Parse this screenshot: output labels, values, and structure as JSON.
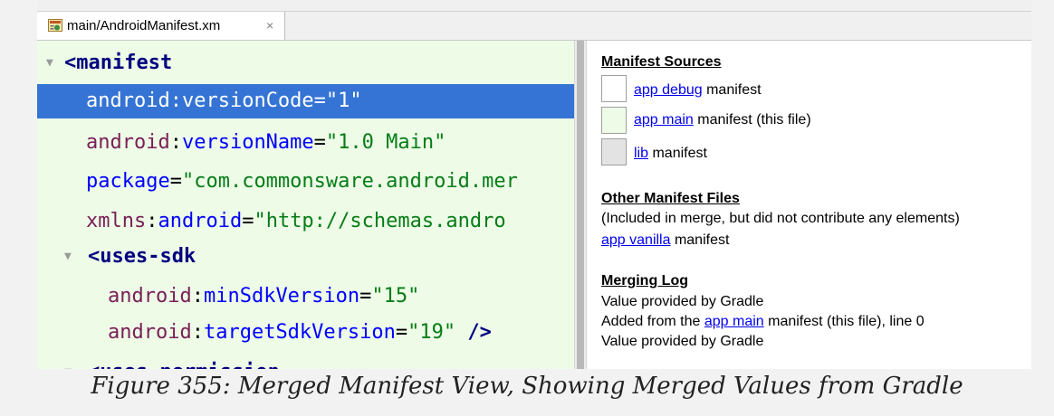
{
  "editor_tab": {
    "title": "main/AndroidManifest.xm",
    "close": "×",
    "icon": "xml-file-icon"
  },
  "xml_editor": {
    "selected_line": 1,
    "lines": [
      {
        "fold": "▼",
        "parts": [
          [
            "bracket",
            "<manifest"
          ]
        ]
      },
      {
        "parts": [
          [
            "ns",
            "android"
          ],
          [
            "eq",
            ":"
          ],
          [
            "attr",
            "versionCode"
          ],
          [
            "eq",
            "="
          ],
          [
            "val",
            "\"1\""
          ]
        ]
      },
      {
        "parts": [
          [
            "ns",
            "android"
          ],
          [
            "eq",
            ":"
          ],
          [
            "attr",
            "versionName"
          ],
          [
            "eq",
            "="
          ],
          [
            "val",
            "\"1.0 Main\""
          ]
        ]
      },
      {
        "parts": [
          [
            "attr",
            "package"
          ],
          [
            "eq",
            "="
          ],
          [
            "val",
            "\"com.commonsware.android.mer"
          ]
        ]
      },
      {
        "parts": [
          [
            "ns",
            "xmlns"
          ],
          [
            "eq",
            ":"
          ],
          [
            "attr",
            "android"
          ],
          [
            "eq",
            "="
          ],
          [
            "val",
            "\"http://schemas.andro"
          ]
        ]
      },
      {
        "fold": "▼",
        "parts": [
          [
            "bracket",
            "<uses-sdk"
          ]
        ]
      },
      {
        "parts": [
          [
            "ns",
            "android"
          ],
          [
            "eq",
            ":"
          ],
          [
            "attr",
            "minSdkVersion"
          ],
          [
            "eq",
            "="
          ],
          [
            "val",
            "\"15\""
          ]
        ]
      },
      {
        "parts": [
          [
            "ns",
            "android"
          ],
          [
            "eq",
            ":"
          ],
          [
            "attr",
            "targetSdkVersion"
          ],
          [
            "eq",
            "="
          ],
          [
            "val",
            "\"19\""
          ],
          [
            "bracket",
            " />"
          ]
        ]
      },
      {
        "fold": "▼",
        "parts": [
          [
            "bracket",
            "<uses-permission"
          ]
        ]
      }
    ]
  },
  "manifest_sources": {
    "heading": "Manifest Sources",
    "items": [
      {
        "link": "app debug",
        "rest": " manifest",
        "swatch_color": "#ffffff"
      },
      {
        "link": "app main",
        "rest": " manifest (this file)",
        "swatch_color": "#edfbe7"
      },
      {
        "link": "lib",
        "rest": " manifest",
        "swatch_color": "#e3e3e3"
      }
    ]
  },
  "other_manifest_files": {
    "heading": "Other Manifest Files",
    "note": "(Included in merge, but did not contribute any elements)",
    "link": "app vanilla",
    "rest": " manifest"
  },
  "merging_log": {
    "heading": "Merging Log",
    "line1": "Value provided by Gradle",
    "line2_prefix": "Added from the ",
    "line2_link": "app main",
    "line2_suffix": " manifest (this file), line 0",
    "line3": "Value provided by Gradle"
  },
  "caption": "Figure 355: Merged Manifest View, Showing Merged Values from Gradle",
  "colors": {
    "editor_background": "#edfbe7",
    "selection": "#3574d4",
    "link": "#0000ee"
  }
}
